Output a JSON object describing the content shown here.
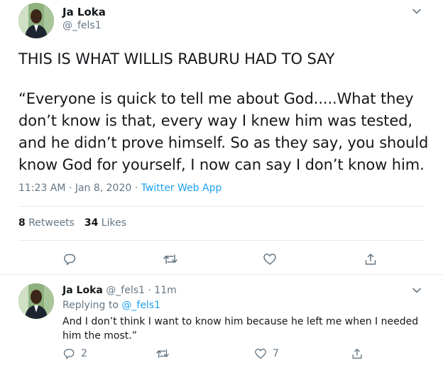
{
  "colors": {
    "link": "#1da1f2",
    "secondary_text": "#657786",
    "primary_text": "#14171a",
    "divider": "#e6ecf0",
    "avatar_bg": "#7aa36b"
  },
  "tweet": {
    "author_name": "Ja Loka",
    "author_handle": "@_fels1",
    "headline": "THIS IS WHAT WILLIS RABURU HAD TO SAY",
    "body": "“Everyone is quick to tell me about God.....What they don’t know is that, every way I knew him was tested, and he didn’t prove himself. So as they say, you should know God for yourself, I now can say I don’t know him.",
    "time": "11:23 AM",
    "date_sep": " · ",
    "date": "Jan 8, 2020",
    "source_sep": " · ",
    "source": "Twitter Web App",
    "retweets_count": "8",
    "retweets_label": " Retweets",
    "likes_count": "34",
    "likes_label": " Likes",
    "icons": [
      "reply-icon",
      "retweet-icon",
      "like-icon",
      "share-icon",
      "chevron-down-icon"
    ]
  },
  "reply": {
    "author_name": "Ja Loka",
    "author_handle": "@_fels1",
    "time_sep": " · ",
    "time": "11m",
    "replying_label": "Replying to ",
    "replying_handle": "@_fels1",
    "body": "And I don’t think I want to know him because he left me when I needed him the most.”",
    "reply_count": "2",
    "retweet_count": "",
    "like_count": "7",
    "share_count": ""
  }
}
